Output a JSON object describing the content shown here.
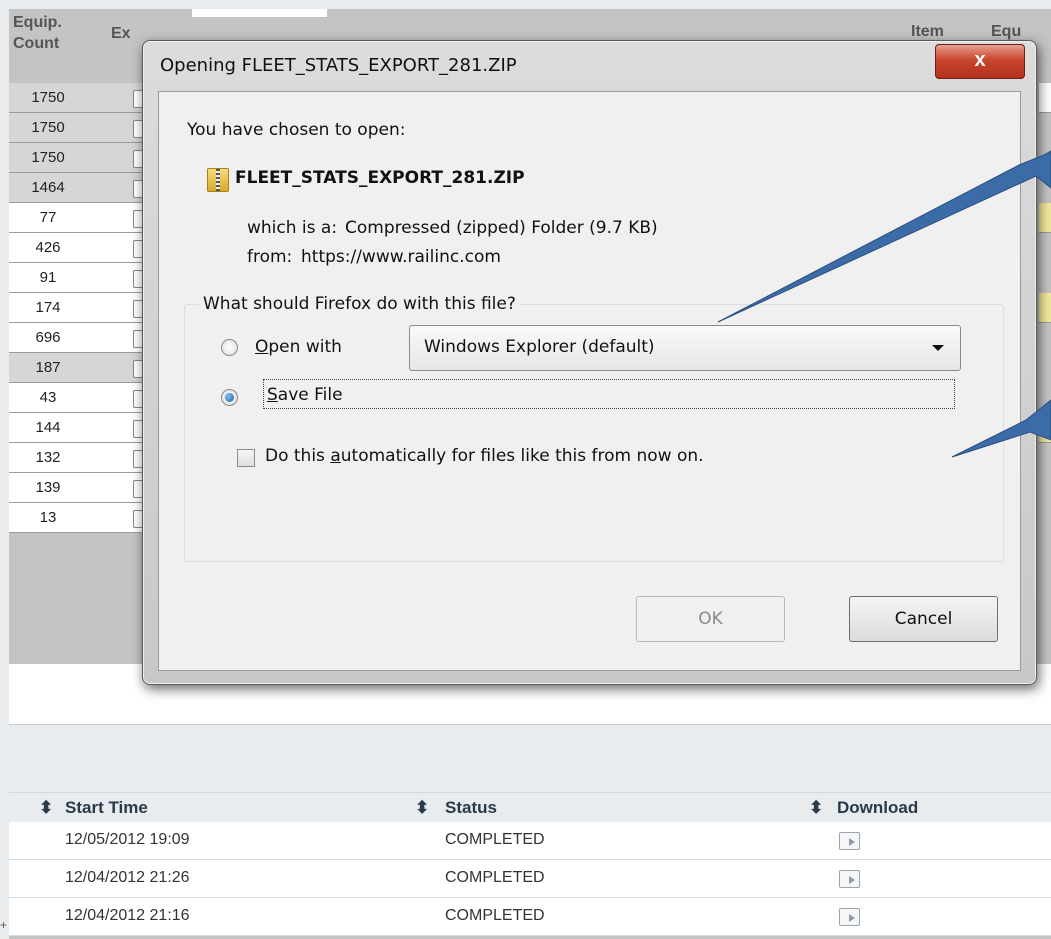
{
  "background_table": {
    "headers": {
      "equip_count_line1": "Equip.",
      "equip_count_line2": "Count",
      "col2_partial": "Ex",
      "item_partial": "Item",
      "equip_right_partial": "Equ"
    },
    "rows": [
      "1750",
      "1750",
      "1750",
      "1464",
      "77",
      "426",
      "91",
      "174",
      "696",
      "187",
      "43",
      "144",
      "132",
      "139",
      "13"
    ]
  },
  "download_grid": {
    "columns": {
      "start_time": "Start Time",
      "status": "Status",
      "download": "Download"
    },
    "rows": [
      {
        "start_time": "12/05/2012 19:09",
        "status": "COMPLETED"
      },
      {
        "start_time": "12/04/2012 21:26",
        "status": "COMPLETED"
      },
      {
        "start_time": "12/04/2012 21:16",
        "status": "COMPLETED"
      }
    ]
  },
  "dialog": {
    "title": "Opening FLEET_STATS_EXPORT_281.ZIP",
    "close_label": "x",
    "intro": "You have chosen to open:",
    "filename": "FLEET_STATS_EXPORT_281.ZIP",
    "which_is_label": "which is a:",
    "which_is_value": "Compressed (zipped) Folder (9.7 KB)",
    "from_label": "from:",
    "from_value": "https://www.railinc.com",
    "question": "What should Firefox do with this file?",
    "open_with_label": "Open with",
    "open_with_value": "Windows Explorer (default)",
    "save_file_label": "Save File",
    "auto_label": "Do this automatically for files like this from now on.",
    "ok_label": "OK",
    "cancel_label": "Cancel"
  }
}
